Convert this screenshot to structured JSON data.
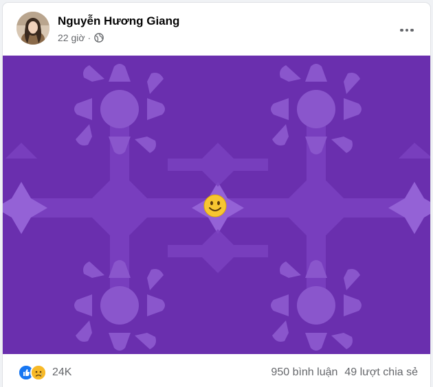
{
  "post": {
    "author": "Nguyễn Hương Giang",
    "time": "22 giờ",
    "separator": "·",
    "privacy_icon": "globe-icon",
    "more_icon": "more-horizontal-icon"
  },
  "image": {
    "background_color": "#6a2fae",
    "pattern_color": "#7d45c2",
    "flower_color": "#8f5cd0",
    "center_emoji": "🙂"
  },
  "footer": {
    "reactions": [
      "like-reaction-icon",
      "sad-reaction-icon"
    ],
    "reaction_count": "24K",
    "comments": "950 bình luận",
    "shares": "49 lượt chia sẻ"
  },
  "colors": {
    "like_blue": "#1877f2",
    "sad_yellow": "#f7b928",
    "text_secondary": "#65676b"
  }
}
